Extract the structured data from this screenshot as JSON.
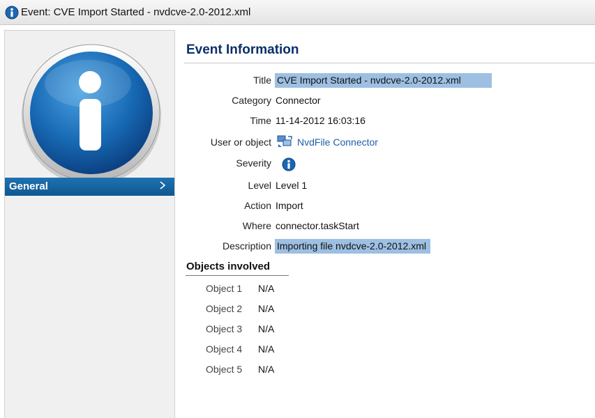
{
  "window": {
    "title": "Event: CVE Import Started - nvdcve-2.0-2012.xml",
    "title_icon": "info-icon"
  },
  "sidebar": {
    "graphic": "large-info-icon",
    "nav_items": [
      {
        "label": "General",
        "icon": "chevron-right-icon",
        "selected": true
      }
    ]
  },
  "event": {
    "heading": "Event Information",
    "fields": {
      "title": {
        "label": "Title",
        "value": "CVE Import Started - nvdcve-2.0-2012.xml",
        "highlighted": true
      },
      "category": {
        "label": "Category",
        "value": "Connector"
      },
      "time": {
        "label": "Time",
        "value": "11-14-2012 16:03:16"
      },
      "user": {
        "label": "User or object",
        "value": "NvdFile Connector",
        "icon": "connector-icon"
      },
      "severity": {
        "label": "Severity",
        "icon": "info-icon"
      },
      "level": {
        "label": "Level",
        "value": "Level 1"
      },
      "action": {
        "label": "Action",
        "value": "Import"
      },
      "where": {
        "label": "Where",
        "value": "connector.taskStart"
      },
      "description": {
        "label": "Description",
        "value": "Importing file nvdcve-2.0-2012.xml",
        "highlighted": true
      }
    }
  },
  "objects": {
    "heading": "Objects involved",
    "items": [
      {
        "label": "Object 1",
        "value": "N/A"
      },
      {
        "label": "Object 2",
        "value": "N/A"
      },
      {
        "label": "Object 3",
        "value": "N/A"
      },
      {
        "label": "Object 4",
        "value": "N/A"
      },
      {
        "label": "Object 5",
        "value": "N/A"
      }
    ]
  },
  "colors": {
    "heading": "#0a2f6b",
    "nav_selected": "#1565a6",
    "highlight": "#9dbfe2",
    "link": "#1f5fa8"
  }
}
